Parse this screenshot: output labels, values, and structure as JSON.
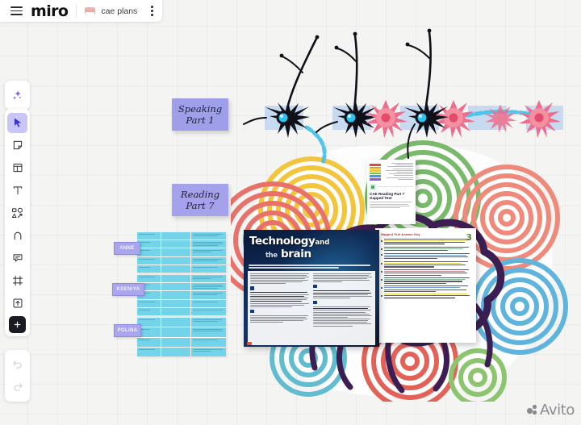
{
  "app": {
    "brand": "miro",
    "tab_label": "cae plans",
    "menu_icon": "hamburger-icon",
    "tab_icon": "board-thumbnail-icon",
    "kebab_icon": "more-options-icon"
  },
  "toolbar": {
    "ai_tool": {
      "name": "ai-sparkle-tool",
      "label": "AI"
    },
    "items": [
      {
        "name": "select-tool",
        "label": "Select",
        "icon": "cursor-icon",
        "selected": true
      },
      {
        "name": "sticky-tool",
        "label": "Sticky note",
        "icon": "sticky-note-icon",
        "selected": false
      },
      {
        "name": "template-tool",
        "label": "Templates",
        "icon": "template-icon",
        "selected": false
      },
      {
        "name": "text-tool",
        "label": "Text",
        "icon": "text-t-icon",
        "selected": false
      },
      {
        "name": "shapes-tool",
        "label": "Shapes",
        "icon": "shapes-icon",
        "selected": false
      },
      {
        "name": "pen-tool",
        "label": "Pen",
        "icon": "pen-icon",
        "selected": false
      },
      {
        "name": "comment-tool",
        "label": "Comment",
        "icon": "comment-icon",
        "selected": false
      },
      {
        "name": "frame-tool",
        "label": "Frame",
        "icon": "frame-icon",
        "selected": false
      },
      {
        "name": "upload-tool",
        "label": "Upload",
        "icon": "upload-icon",
        "selected": false
      },
      {
        "name": "more-apps-tool",
        "label": "More apps",
        "icon": "plus-icon",
        "selected": false
      }
    ],
    "undo": {
      "name": "undo-button",
      "label": "Undo",
      "icon": "undo-arrow-icon",
      "disabled": true
    },
    "redo": {
      "name": "redo-button",
      "label": "Redo",
      "icon": "redo-arrow-icon",
      "disabled": true
    }
  },
  "board": {
    "sticky_notes": [
      {
        "name": "sticky-speaking-part-1",
        "text": "Speaking\nPart 1",
        "color": "#9f9ee9"
      },
      {
        "name": "sticky-reading-part-7",
        "text": "Reading\nPart 7",
        "color": "#a3a2ea"
      }
    ],
    "name_chips": [
      {
        "name": "name-chip-anne",
        "text": "ANNE"
      },
      {
        "name": "name-chip-kseniya",
        "text": "KSENIYA"
      },
      {
        "name": "name-chip-polina",
        "text": "POLINA"
      }
    ],
    "tables": [
      {
        "name": "lesson-plan-table-1",
        "color": "#73d3e8",
        "rows": 5,
        "columns": 3
      },
      {
        "name": "lesson-plan-table-2",
        "color": "#73d3e8",
        "rows": 5,
        "columns": 3
      },
      {
        "name": "lesson-plan-table-3",
        "color": "#73d3e8",
        "rows": 4,
        "columns": 3
      }
    ],
    "cae_card": {
      "name": "cae-reading-part-7-card",
      "title": "CAE Reading Part 7 Gapped Text",
      "logo": "green-app-logo-icon",
      "legend_colors": [
        "#e24a3c",
        "#f0962f",
        "#f2c53d",
        "#6fbf54",
        "#3f9de0",
        "#8e5ec7"
      ]
    },
    "tech_slide": {
      "name": "technology-and-the-brain-slide",
      "title_line1_main": "Technology",
      "title_line1_tail": "and",
      "title_line2_lead": "the",
      "title_line2_main": "brain",
      "background": "#0d2347"
    },
    "worksheet": {
      "name": "reading-answer-key-document",
      "heading": "Gapped Text Answer Key",
      "page_number": "3",
      "bullet_count": 9
    },
    "artwork": {
      "name": "colorful-brain-artwork",
      "palette": [
        "#f2c53d",
        "#e8716a",
        "#79b96b",
        "#5fb4dd",
        "#3c1f52",
        "#e8a23d"
      ]
    },
    "neurons": {
      "name": "neuron-illustration-row",
      "dark_neuron_color": "#111118",
      "nucleus_color": "#29c4f0",
      "pink_neuron_color": "#ee6d8c",
      "axon_color": "#49c3ea",
      "block_color": "#b9d2ef"
    }
  },
  "watermark": {
    "name": "avito-watermark",
    "text": "Avito"
  }
}
